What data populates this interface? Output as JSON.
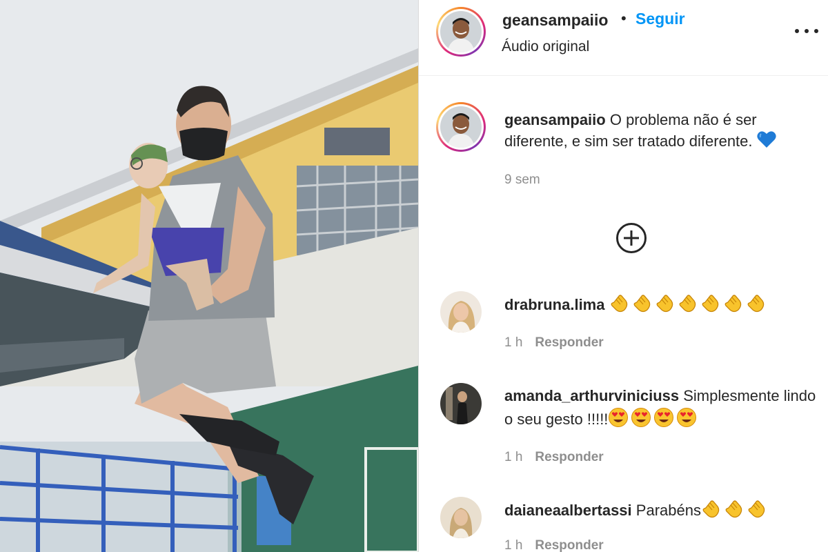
{
  "post": {
    "username": "geansampaiio",
    "separator": "•",
    "follow_label": "Seguir",
    "audio": "Áudio original",
    "more_icon": "more-options-icon"
  },
  "caption": {
    "username": "geansampaiio",
    "text": "O problema não é ser diferente, e sim ser tratado diferente.",
    "emoji": "blue-heart",
    "time": "9 sem"
  },
  "load_more_icon": "plus-circle-icon",
  "comments": [
    {
      "username": "drabruna.lima",
      "text": "",
      "emojis": [
        "clap",
        "clap",
        "clap",
        "clap",
        "clap",
        "clap",
        "clap"
      ],
      "time": "1 h",
      "reply_label": "Responder"
    },
    {
      "username": "amanda_arthurviniciuss",
      "text": "Simplesmente lindo o seu gesto !!!!!",
      "emojis": [
        "heart-eyes",
        "heart-eyes",
        "heart-eyes",
        "heart-eyes"
      ],
      "time": "1 h",
      "reply_label": "Responder"
    },
    {
      "username": "daianeaalbertassi",
      "text": "Parabéns",
      "emojis": [
        "clap",
        "clap",
        "clap"
      ],
      "time": "1 h",
      "reply_label": "Responder"
    }
  ],
  "colors": {
    "link_blue": "#0095f6",
    "text": "#262626",
    "muted": "#8e8e8e",
    "heart": "#1f7bd6",
    "border": "#dbdbdb"
  }
}
